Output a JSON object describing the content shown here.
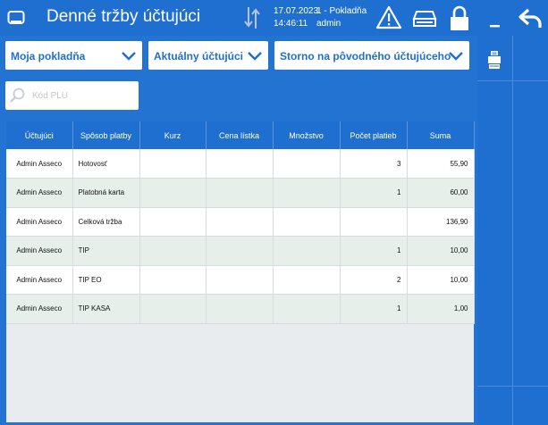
{
  "header": {
    "title": "Denné tržby účtujúci",
    "date": "17.07.2023",
    "time": "14:46:11",
    "register": "1 - Pokladňa",
    "user": "admin"
  },
  "filters": {
    "register_select": "Moja pokladňa",
    "cashier_select": "Aktuálny účtujúci",
    "storno_select": "Storno na pôvodného účtujúceho"
  },
  "search": {
    "placeholder": "Kód PLU",
    "value": ""
  },
  "table": {
    "columns": [
      "Účtujúci",
      "Spôsob platby",
      "Kurz",
      "Cena lístka",
      "Množstvo",
      "Počet platieb",
      "Suma"
    ],
    "rows": [
      [
        "Admin Asseco",
        "Hotovosť",
        "",
        "",
        "",
        "3",
        "55,90"
      ],
      [
        "Admin Asseco",
        "Platobná karta",
        "",
        "",
        "",
        "1",
        "60,00"
      ],
      [
        "Admin Asseco",
        "Celková tržba",
        "",
        "",
        "",
        "",
        "136,90"
      ],
      [
        "Admin Asseco",
        "TIP",
        "",
        "",
        "",
        "1",
        "10,00"
      ],
      [
        "Admin Asseco",
        "TIP EO",
        "",
        "",
        "",
        "2",
        "10,00"
      ],
      [
        "Admin Asseco",
        "TIP KASA",
        "",
        "",
        "",
        "1",
        "1,00"
      ]
    ]
  },
  "colors": {
    "primary": "#1f6fd0",
    "row_alt": "#e6efea",
    "warning_icon": "#ffffff"
  },
  "icons": [
    "app-icon",
    "sync-arrows-icon",
    "warning-icon",
    "printer-icon",
    "lock-icon",
    "minimize-icon",
    "back-arrow-icon",
    "search-icon",
    "chevron-down-icon",
    "receipt-printer-icon"
  ]
}
